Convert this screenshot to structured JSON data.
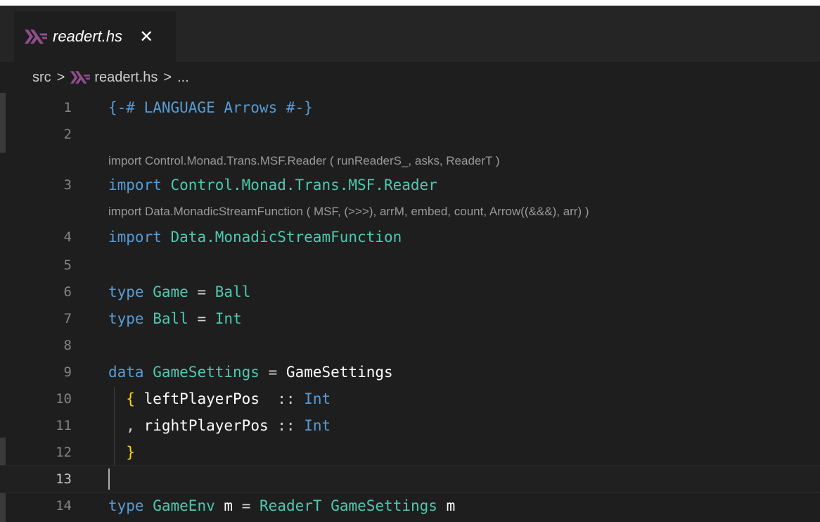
{
  "tab": {
    "filename": "readert.hs",
    "close_glyph": "✕"
  },
  "breadcrumb": {
    "folder": "src",
    "file": "readert.hs",
    "more": "...",
    "separator": ">"
  },
  "lens": {
    "reader_import": "import Control.Monad.Trans.MSF.Reader ( runReaderS_, asks, ReaderT )",
    "msf_import": "import Data.MonadicStreamFunction ( MSF, (>>>), arrM, embed, count, Arrow((&&&), arr) )"
  },
  "line_numbers": [
    "1",
    "2",
    "3",
    "4",
    "5",
    "6",
    "7",
    "8",
    "9",
    "10",
    "11",
    "12",
    "13",
    "14"
  ],
  "code": {
    "l1": {
      "pragma": "{-# LANGUAGE Arrows #-}"
    },
    "l3": {
      "kw": "import",
      "module": "Control.Monad.Trans.MSF.Reader"
    },
    "l4": {
      "kw": "import",
      "module": "Data.MonadicStreamFunction"
    },
    "l6": {
      "kw": "type",
      "name": "Game",
      "eq": "=",
      "rhs": "Ball"
    },
    "l7": {
      "kw": "type",
      "name": "Ball",
      "eq": "=",
      "rhs": "Int"
    },
    "l9": {
      "kw": "data",
      "name": "GameSettings",
      "eq": "=",
      "ctor": "GameSettings"
    },
    "l10": {
      "open": "{",
      "field": "leftPlayerPos",
      "sig": "::",
      "type": "Int"
    },
    "l11": {
      "comma": ",",
      "field": "rightPlayerPos",
      "sig": "::",
      "type": "Int"
    },
    "l12": {
      "close": "}"
    },
    "l14": {
      "kw": "type",
      "name": "GameEnv",
      "var": "m",
      "eq": "=",
      "t1": "ReaderT",
      "t2": "GameSettings",
      "var2": "m"
    }
  },
  "colors": {
    "background": "#1e1e1e",
    "keyword": "#569cd6",
    "type": "#4ec9b0",
    "field": "#9cdcfe",
    "line_number": "#858585",
    "lens": "#999999"
  },
  "icons": {
    "haskell": "haskell-file-icon"
  }
}
